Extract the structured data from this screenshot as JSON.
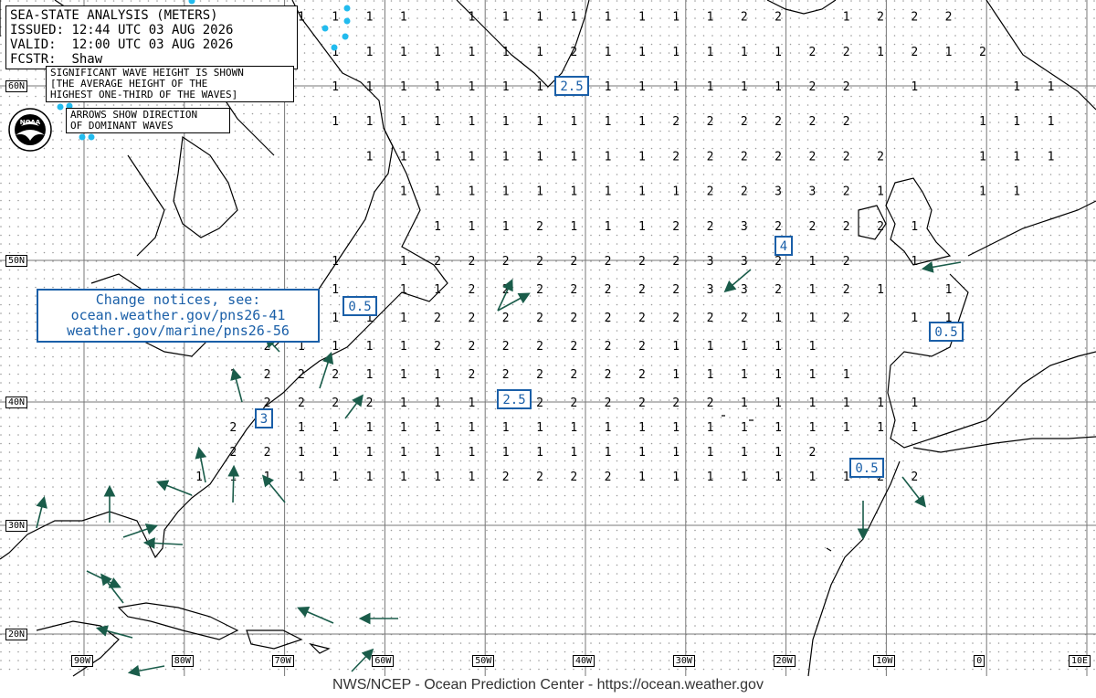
{
  "header": {
    "title": "SEA-STATE ANALYSIS (METERS)",
    "issued_label": "ISSUED:",
    "issued_value": "12:44 UTC 03 AUG 2026",
    "valid_label": "VALID:",
    "valid_value": "12:00 UTC 03 AUG 2026",
    "forecaster_label": "FCSTR:",
    "forecaster_value": "Shaw"
  },
  "legend": {
    "sig_wave_line1": "SIGNIFICANT WAVE HEIGHT IS SHOWN",
    "sig_wave_line2": "[THE AVERAGE HEIGHT OF THE",
    "sig_wave_line3": "HIGHEST ONE-THIRD OF THE WAVES]",
    "arrows_line1": "ARROWS SHOW DIRECTION",
    "arrows_line2": "OF DOMINANT WAVES"
  },
  "logo": {
    "text": "NOAA",
    "icon": "noaa-logo-icon"
  },
  "notice": {
    "line1": "Change notices, see:",
    "line2": "ocean.weather.gov/pns26-41",
    "line3": "weather.gov/marine/pns26-56"
  },
  "footer": {
    "text": "NWS/NCEP - Ocean Prediction Center - https://ocean.weather.gov"
  },
  "colors": {
    "wave_box": "#1a5fa8",
    "arrow": "#1a5c4a",
    "buoy": "#22bbee",
    "coast": "#000000",
    "grid": "#888888"
  },
  "lat_labels": [
    "60N",
    "50N",
    "40N",
    "30N",
    "20N"
  ],
  "lon_labels": [
    "90W",
    "80W",
    "70W",
    "60W",
    "50W",
    "40W",
    "30W",
    "20W",
    "10W",
    "0",
    "10E"
  ],
  "boxed_heights": [
    "2.5",
    "0.5",
    "4",
    "0.5",
    "2.5",
    "3",
    "0.5"
  ],
  "grid_rows": [
    {
      "lat": 66,
      "values": "......1111.111111.22222222"
    },
    {
      "lat": 64,
      "values": "...1111.1111111122.1222"
    },
    {
      "lat": 62,
      "values": "....11111112111111221212"
    },
    {
      "lat": 60,
      "values": "....1111111111111122.1..11"
    },
    {
      "lat": 58,
      "values": "....1111111111222222...111"
    },
    {
      "lat": 56,
      "values": ".....1111111112222222..111"
    },
    {
      "lat": 54,
      "values": "......111111111223321..11"
    },
    {
      "lat": 52,
      "values": ".......111211122322221"
    },
    {
      "lat": 50,
      "values": "....1.12222222233212.1"
    },
    {
      "lat": 48,
      "values": "....1.112222222332121.1"
    },
    {
      "lat": 46,
      "values": "...11112222222222112.11"
    },
    {
      "lat": 44,
      "values": "..21111222222211111"
    },
    {
      "lat": 42,
      "values": ".1222111222222111111"
    },
    {
      "lat": 40,
      "values": "..22221111222222111111"
    },
    {
      "lat": 38,
      "values": ".2.1111111111111111111"
    },
    {
      "lat": 36,
      "values": ".221111111111111112"
    },
    {
      "lat": 34,
      "values": "1111111112222111111122"
    }
  ]
}
